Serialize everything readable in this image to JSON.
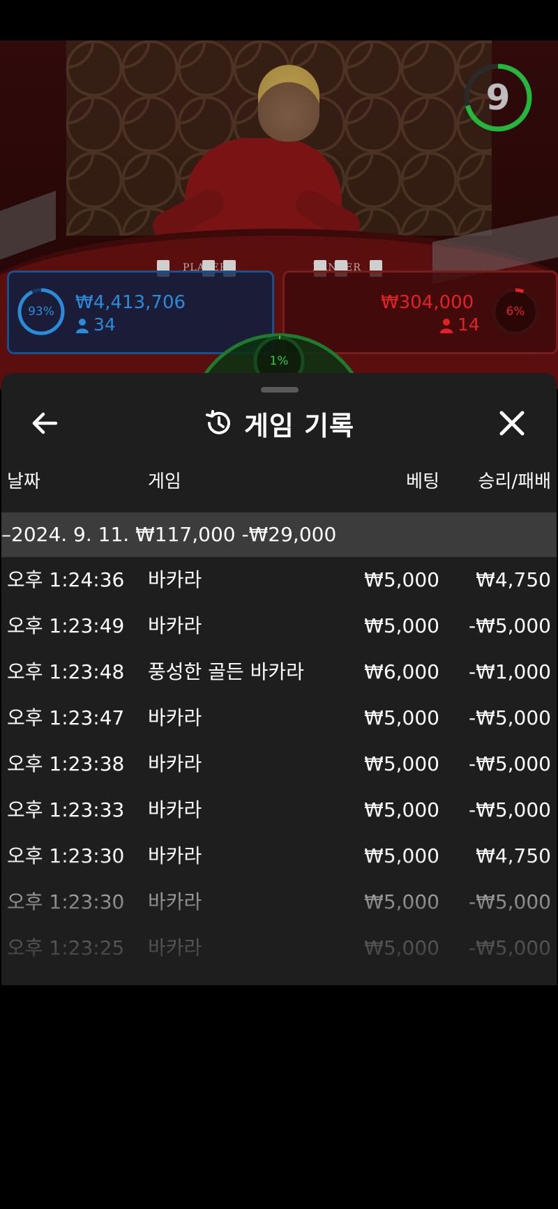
{
  "video": {
    "countdown": "9",
    "table_labels": {
      "player": "PLAYER",
      "banker": "BANKER"
    },
    "player_bet": {
      "percent_label": "93%",
      "percent": 93,
      "amount": "₩4,413,706",
      "players": "34"
    },
    "banker_bet": {
      "percent_label": "6%",
      "percent": 6,
      "amount": "₩304,000",
      "players": "14"
    },
    "tie_bet": {
      "percent_label": "1%",
      "percent": 1
    },
    "colors": {
      "player": "#2a8bd8",
      "banker": "#e02424",
      "tie": "#2ecc40",
      "timer": "#23b83a"
    }
  },
  "history": {
    "title": "게임 기록",
    "icons": {
      "back": "arrow-left-icon",
      "history": "history-icon",
      "close": "close-icon"
    },
    "columns": {
      "date": "날짜",
      "game": "게임",
      "bet": "베팅",
      "result": "승리/패배"
    },
    "date_group": {
      "toggle": "–",
      "date": "2024. 9. 11.",
      "bet_total": "₩117,000",
      "result_total": "-₩29,000"
    },
    "rows": [
      {
        "time": "오후 1:24:36",
        "game": "바카라",
        "bet": "₩5,000",
        "result": "₩4,750"
      },
      {
        "time": "오후 1:23:49",
        "game": "바카라",
        "bet": "₩5,000",
        "result": "-₩5,000"
      },
      {
        "time": "오후 1:23:48",
        "game": "풍성한 골든 바카라",
        "bet": "₩6,000",
        "result": "-₩1,000"
      },
      {
        "time": "오후 1:23:47",
        "game": "바카라",
        "bet": "₩5,000",
        "result": "-₩5,000"
      },
      {
        "time": "오후 1:23:38",
        "game": "바카라",
        "bet": "₩5,000",
        "result": "-₩5,000"
      },
      {
        "time": "오후 1:23:33",
        "game": "바카라",
        "bet": "₩5,000",
        "result": "-₩5,000"
      },
      {
        "time": "오후 1:23:30",
        "game": "바카라",
        "bet": "₩5,000",
        "result": "₩4,750"
      },
      {
        "time": "오후 1:23:30",
        "game": "바카라",
        "bet": "₩5,000",
        "result": "-₩5,000"
      },
      {
        "time": "오후 1:23:25",
        "game": "바카라",
        "bet": "₩5,000",
        "result": "-₩5,000"
      }
    ]
  }
}
